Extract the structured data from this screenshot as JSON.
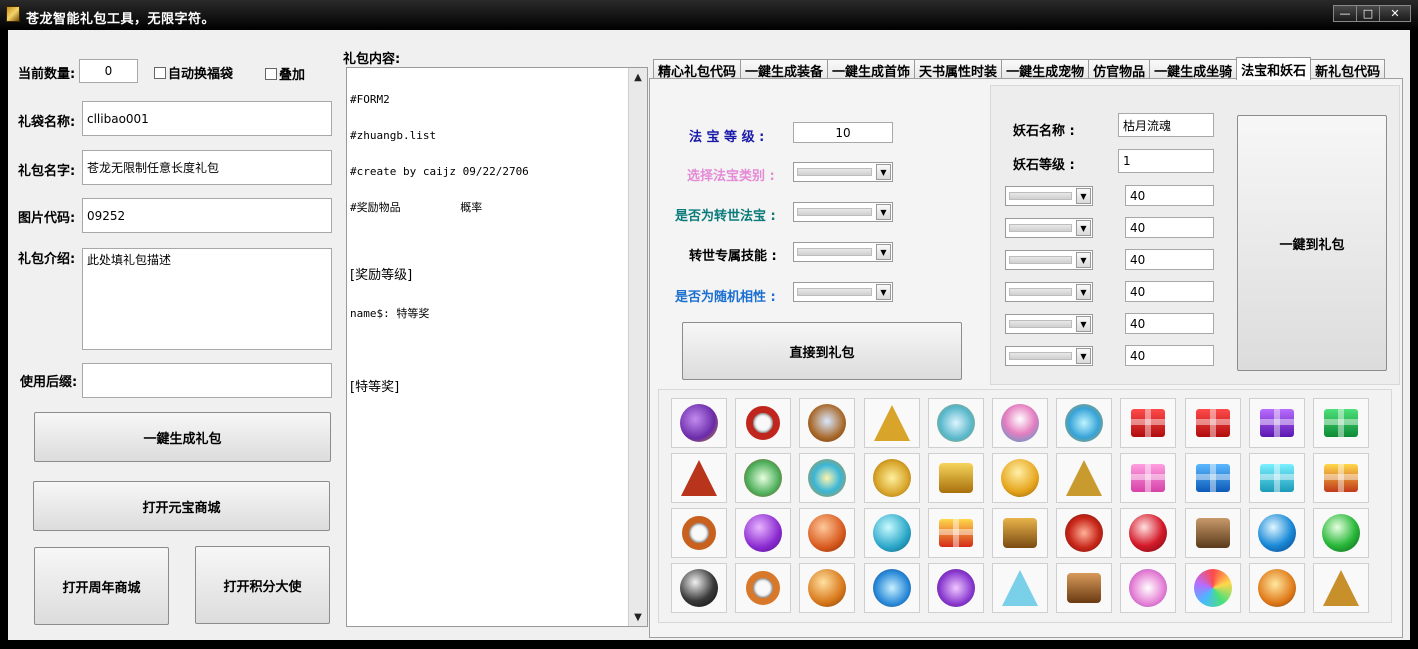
{
  "window": {
    "title": "苍龙智能礼包工具，无限字符。",
    "minimize": "—",
    "maximize": "□",
    "close": "✕"
  },
  "left": {
    "quantity_label": "当前数量:",
    "quantity_value": "0",
    "auto_bag_label": "自动换福袋",
    "stack_label": "叠加",
    "bag_name_label": "礼袋名称:",
    "bag_name_value": "cllibao001",
    "pack_name_label": "礼包名字:",
    "pack_name_value": "苍龙无限制任意长度礼包",
    "image_code_label": "图片代码:",
    "image_code_value": "09252",
    "desc_label": "礼包介绍:",
    "desc_value": "此处填礼包描述",
    "suffix_label": "使用后缀:",
    "suffix_value": "",
    "generate_button": "一鍵生成礼包",
    "open_yuanbao_button": "打开元宝商城",
    "open_anniversary_button": "打开周年商城",
    "open_points_button": "打开积分大使"
  },
  "content": {
    "label": "礼包内容:",
    "lines": [
      "#FORM2",
      "#zhuangb.list",
      "#create by caijz 09/22/2706",
      "#奖励物品         概率",
      "",
      "[奖励等级]",
      "name$: 特等奖",
      "",
      "[特等奖]"
    ]
  },
  "tabs": [
    {
      "label": "精心礼包代码",
      "active": false
    },
    {
      "label": "一鍵生成装备",
      "active": false
    },
    {
      "label": "一鍵生成首饰",
      "active": false
    },
    {
      "label": "天书属性时装",
      "active": false
    },
    {
      "label": "一鍵生成宠物",
      "active": false
    },
    {
      "label": "仿官物品",
      "active": false
    },
    {
      "label": "一鍵生成坐骑",
      "active": false
    },
    {
      "label": "法宝和妖石",
      "active": true
    },
    {
      "label": "新礼包代码",
      "active": false
    }
  ],
  "fabao": {
    "level_label": "法 宝 等 级 :",
    "level_value": "10",
    "type_label": "选择法宝类别 :",
    "reborn_label": "是否为转世法宝 :",
    "reborn_skill_label": "转世专属技能 :",
    "random_label": "是否为随机相性 :",
    "direct_button": "直接到礼包"
  },
  "yaoshi": {
    "name_label": "妖石名称 :",
    "name_value": "枯月流魂",
    "level_label": "妖石等级 :",
    "level_value": "1",
    "attr_values": [
      "40",
      "40",
      "40",
      "40",
      "40",
      "40"
    ],
    "to_pack_button": "一鍵到礼包"
  },
  "colors": {
    "level_label": "#1a1aa8",
    "type_label": "#e58ad6",
    "reborn_label": "#0a7a7a",
    "reborn_skill_label": "#000000",
    "random_label": "#1a6fd0"
  },
  "icons": [
    [
      "golden-purple-slipper-icon",
      "red-beaded-bracelet-icon",
      "jeweled-mirror-icon",
      "golden-crown-icon",
      "crystal-antlers-icon",
      "lotus-flower-icon",
      "blue-jade-fountain-icon",
      "red-gift-box-icon",
      "red-gift-box-icon",
      "purple-gift-box-icon",
      "green-gift-box-icon"
    ],
    [
      "red-pagoda-icon",
      "jade-scepter-icon",
      "golden-lantern-icon",
      "golden-dragon-icon",
      "golden-seal-icon",
      "golden-gourd-icon",
      "golden-statue-icon",
      "pink-gift-box-icon",
      "blue-gift-box-icon",
      "cyan-gift-box-icon",
      "gold-gift-box-icon"
    ],
    [
      "copper-ring-icon",
      "purple-gem-icon",
      "orange-gem-icon",
      "cyan-gem-icon",
      "gold-red-gift-box-icon",
      "treasure-chest-icon",
      "red-coin-icon",
      "red-orb-icon",
      "bronze-cage-icon",
      "blue-orb-icon",
      "green-orb-icon"
    ],
    [
      "black-pearl-icon",
      "orange-ring-icon",
      "amber-egg-icon",
      "blue-dragon-coil-icon",
      "violet-swirl-icon",
      "crystal-shard-icon",
      "open-chest-icon",
      "pink-lotus-icon",
      "rainbow-halo-icon",
      "golden-plate-icon",
      "golden-urn-icon"
    ]
  ]
}
